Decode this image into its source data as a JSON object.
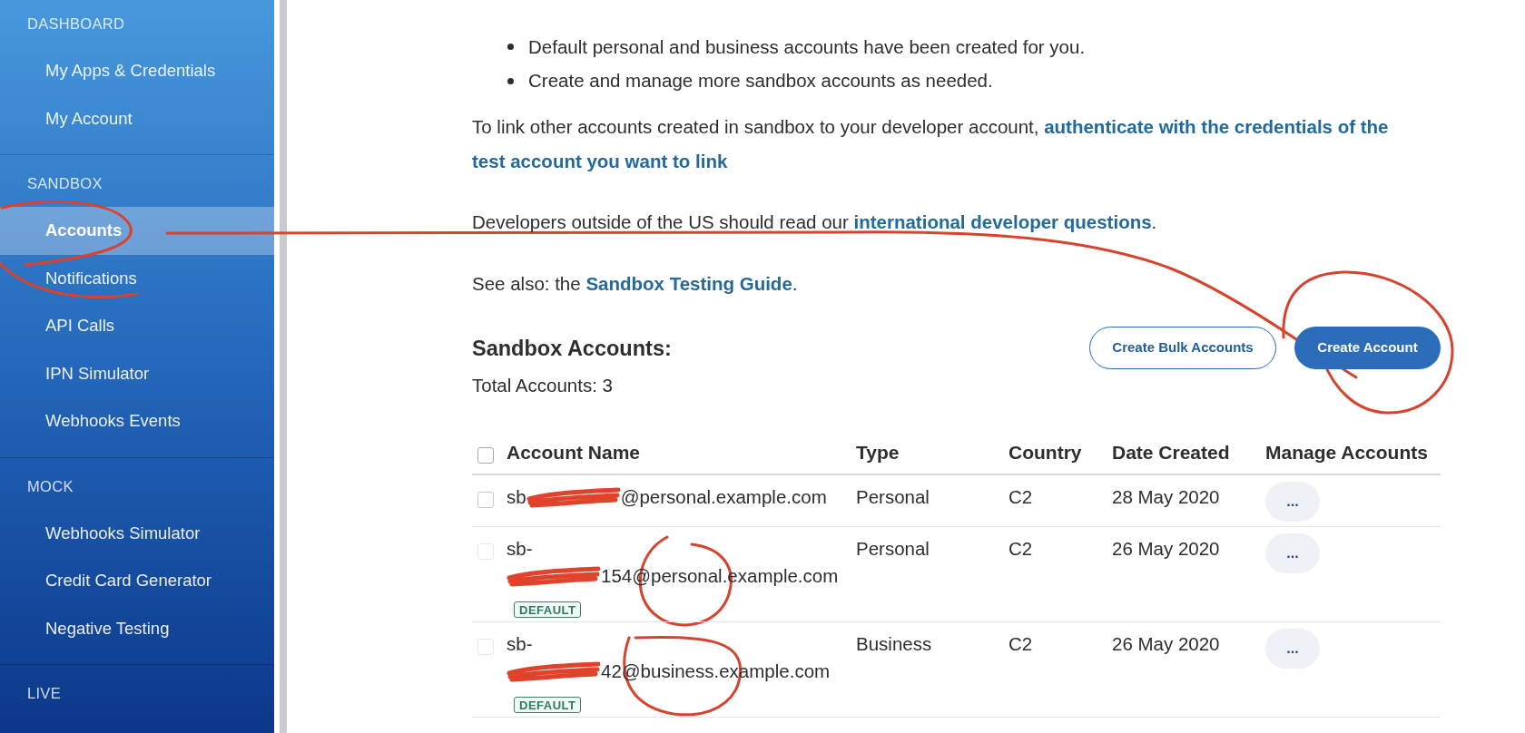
{
  "sidebar": {
    "sections": [
      {
        "title": "DASHBOARD",
        "items": [
          {
            "label": "My Apps & Credentials",
            "selected": false
          },
          {
            "label": "My Account",
            "selected": false
          }
        ]
      },
      {
        "title": "SANDBOX",
        "items": [
          {
            "label": "Accounts",
            "selected": true
          },
          {
            "label": "Notifications",
            "selected": false
          },
          {
            "label": "API Calls",
            "selected": false
          },
          {
            "label": "IPN Simulator",
            "selected": false
          },
          {
            "label": "Webhooks Events",
            "selected": false
          }
        ]
      },
      {
        "title": "MOCK",
        "items": [
          {
            "label": "Webhooks Simulator",
            "selected": false
          },
          {
            "label": "Credit Card Generator",
            "selected": false
          },
          {
            "label": "Negative Testing",
            "selected": false
          }
        ]
      },
      {
        "title": "LIVE"
      }
    ]
  },
  "content": {
    "bullets": [
      "Default personal and business accounts have been created for you.",
      "Create and manage more sandbox accounts as needed."
    ],
    "paragraphs": [
      [
        {
          "kind": "text",
          "text": "To link other accounts created in sandbox to your developer account, "
        },
        {
          "kind": "link",
          "text": "authenticate with the credentials of the"
        },
        {
          "kind": "link",
          "text": "test account you want to link"
        }
      ],
      [
        {
          "kind": "text",
          "text": "Developers outside of the US should read our "
        },
        {
          "kind": "link",
          "text": "international developer questions"
        },
        {
          "kind": "text",
          "text": "."
        }
      ],
      [
        {
          "kind": "text",
          "text": "See also: the "
        },
        {
          "kind": "link",
          "text": "Sandbox Testing Guide"
        },
        {
          "kind": "text",
          "text": "."
        }
      ]
    ]
  },
  "accounts": {
    "title": "Sandbox Accounts:",
    "total": "Total Accounts: 3",
    "buttons": [
      {
        "label": "Create Bulk Accounts",
        "kind": "outline"
      },
      {
        "label": "Create Account",
        "kind": "primary"
      }
    ],
    "table": {
      "select_all": {
        "checked": false
      },
      "columns": [
        "Account Name",
        "Type",
        "Country",
        "Date Created",
        "Manage Accounts"
      ],
      "rows": [
        {
          "checked": false,
          "disabled": false,
          "redacted": true,
          "name_before": "sb",
          "name_after": "@personal.example.com",
          "type": "Personal",
          "country": "C2",
          "date": "28 May 2020",
          "action": "..."
        },
        {
          "checked": false,
          "disabled": true,
          "redacted": true,
          "name_head": "sb-",
          "name_after": "154@personal.example.com",
          "badge": "DEFAULT",
          "type": "Personal",
          "country": "C2",
          "date": "26 May 2020",
          "action": "..."
        },
        {
          "checked": false,
          "disabled": true,
          "redacted": true,
          "name_head": "sb-",
          "name_after": "42@business.example.com",
          "badge": "DEFAULT",
          "type": "Business",
          "country": "C2",
          "date": "26 May 2020",
          "action": "..."
        }
      ]
    }
  }
}
